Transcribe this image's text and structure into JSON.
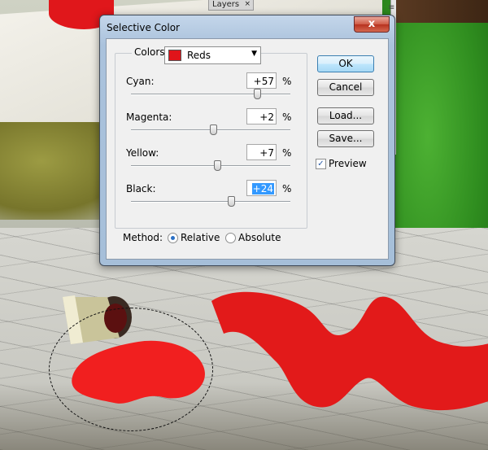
{
  "background": {
    "panel_tab": "Layers",
    "panel_tab_close": "×"
  },
  "dialog": {
    "title": "Selective Color",
    "close_label": "x",
    "colors": {
      "label": "Colors:",
      "selected": "Reds",
      "swatch_color": "#e0141a"
    },
    "sliders": [
      {
        "label": "Cyan:",
        "value": "+57",
        "unit": "%",
        "level": 0.785
      },
      {
        "label": "Magenta:",
        "value": "+2",
        "unit": "%",
        "level": 0.51
      },
      {
        "label": "Yellow:",
        "value": "+7",
        "unit": "%",
        "level": 0.535
      },
      {
        "label": "Black:",
        "value": "+24",
        "unit": "%",
        "level": 0.62
      }
    ],
    "buttons": {
      "ok": "OK",
      "cancel": "Cancel",
      "load": "Load...",
      "save": "Save..."
    },
    "preview": {
      "label": "Preview",
      "checked": true,
      "check_glyph": "✓"
    },
    "method": {
      "label": "Method:",
      "options": [
        "Relative",
        "Absolute"
      ],
      "selected": "Relative"
    }
  }
}
